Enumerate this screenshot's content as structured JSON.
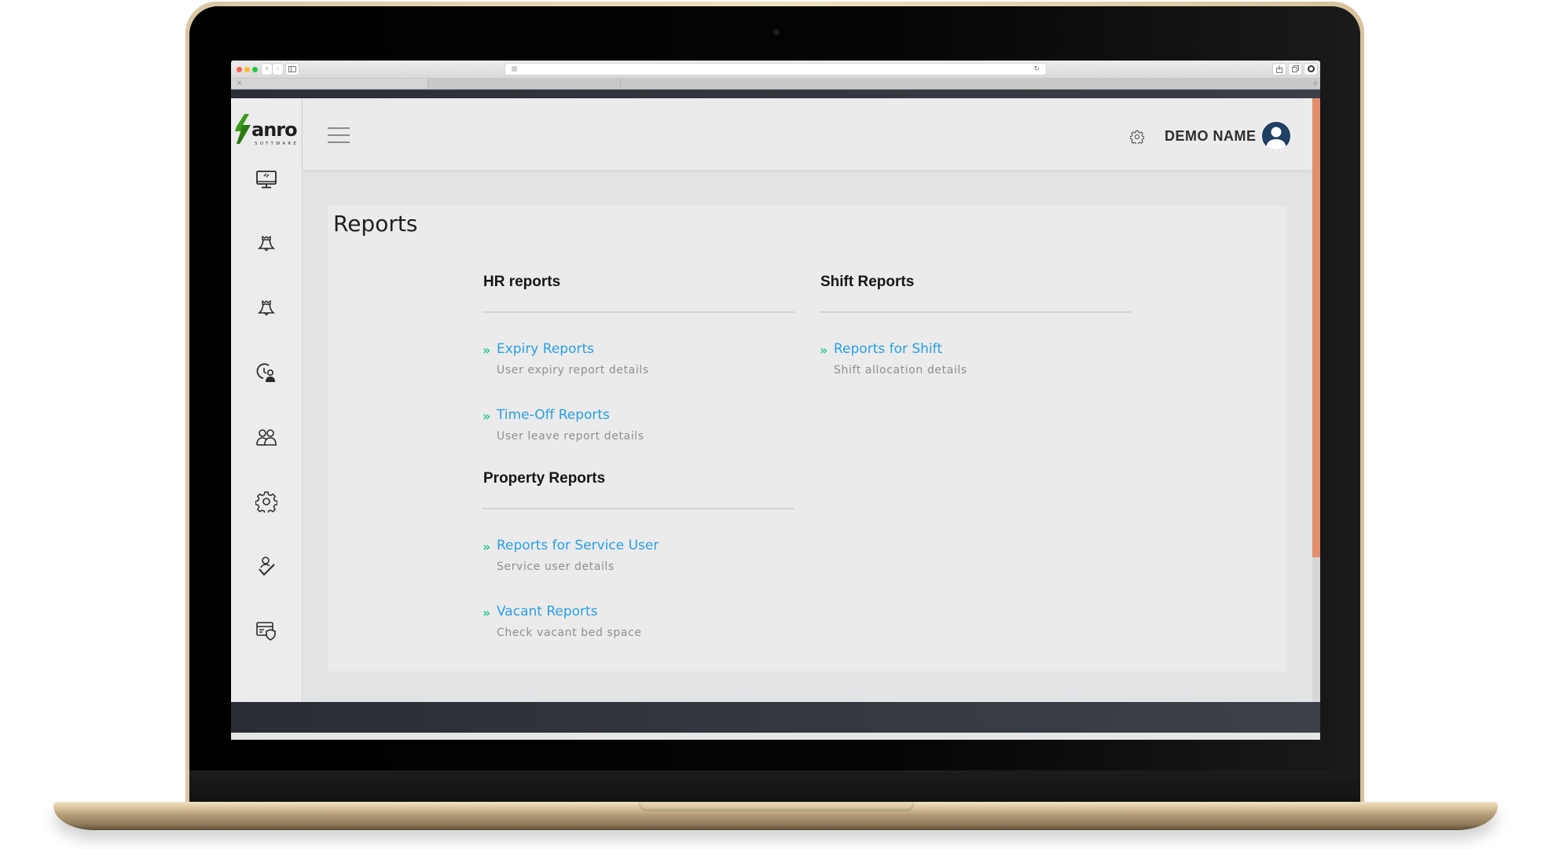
{
  "browser": {
    "tab_close_glyph": "×",
    "tab_new_glyph": "+",
    "nav_back_glyph": "‹",
    "nav_forward_glyph": "›",
    "reload_glyph": "↻",
    "traffic_lights": {
      "close": "#fc5f57",
      "minimize": "#fdbc2e",
      "zoom": "#28c840"
    }
  },
  "sidebar": {
    "logo": {
      "brand": "anro",
      "tagline": "SOFTWARE",
      "accent": "#3b9a1e"
    },
    "items": [
      {
        "id": "dashboard",
        "icon": "monitor-icon"
      },
      {
        "id": "alerts-1",
        "icon": "bell-icon"
      },
      {
        "id": "alerts-2",
        "icon": "bell-icon"
      },
      {
        "id": "time-user",
        "icon": "clock-user-icon"
      },
      {
        "id": "users",
        "icon": "users-icon"
      },
      {
        "id": "settings",
        "icon": "gear-icon"
      },
      {
        "id": "approvals",
        "icon": "user-check-icon"
      },
      {
        "id": "billing",
        "icon": "card-shield-icon"
      }
    ]
  },
  "header": {
    "settings_icon": "gear-icon",
    "user_name": "DEMO NAME",
    "avatar_icon": "user-avatar-icon",
    "avatar_color": "#1f3f63"
  },
  "page": {
    "title": "Reports",
    "sections": [
      {
        "title": "HR reports",
        "reports": [
          {
            "label": "Expiry Reports",
            "description": "User expiry report details"
          },
          {
            "label": "Time-Off Reports",
            "description": "User leave report details"
          }
        ]
      },
      {
        "title": "Shift Reports",
        "reports": [
          {
            "label": "Reports for Shift",
            "description": "Shift allocation details"
          }
        ]
      },
      {
        "title": "Property Reports",
        "reports": [
          {
            "label": "Reports for Service User",
            "description": "Service user details"
          },
          {
            "label": "Vacant Reports",
            "description": "Check vacant bed space"
          }
        ]
      }
    ],
    "chevron_glyph": "»",
    "link_color": "#2a9ee3",
    "chevron_color": "#2ecc8a"
  },
  "scrollbar": {
    "thumb_color": "#e38e6c",
    "position_fraction": 0.0,
    "visible_fraction": 0.76
  }
}
